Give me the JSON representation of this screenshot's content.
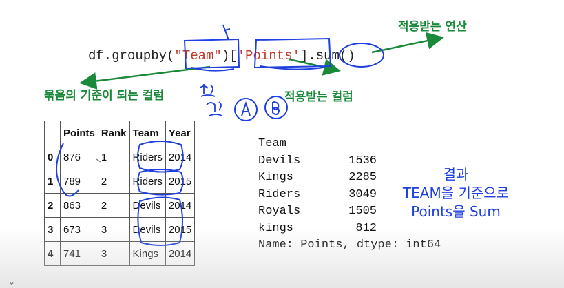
{
  "code": {
    "prefix": "df.groupby(",
    "team_str": "\"Team\"",
    "mid": ")[",
    "points_str": "'Points'",
    "suffix": "].sum()"
  },
  "annotations": {
    "applied_op": "적용받는 연산",
    "group_key": "묶음의 기준이 되는 컬럼",
    "applied_col": "적용받는 컬럼",
    "result_title": "결과",
    "result_line1": "TEAM을 기준으로",
    "result_line2": "Points을 Sum"
  },
  "table": {
    "headers": [
      "",
      "Points",
      "Rank",
      "Team",
      "Year"
    ],
    "rows": [
      [
        "0",
        "876",
        "1",
        "Riders",
        "2014"
      ],
      [
        "1",
        "789",
        "2",
        "Riders",
        "2015"
      ],
      [
        "2",
        "863",
        "2",
        "Devils",
        "2014"
      ],
      [
        "3",
        "673",
        "3",
        "Devils",
        "2015"
      ],
      [
        "4",
        "741",
        "3",
        "Kings",
        "2014"
      ]
    ]
  },
  "series": {
    "index_name": "Team",
    "rows": [
      [
        "Devils",
        "1536"
      ],
      [
        "Kings",
        "2285"
      ],
      [
        "Riders",
        "3049"
      ],
      [
        "Royals",
        "1505"
      ],
      [
        "kings",
        "812"
      ]
    ],
    "footer": "Name: Points, dtype: int64"
  },
  "colors": {
    "ink_blue": "#1f3fe0",
    "arrow_green": "#1a8a3a",
    "string_red": "#c0392b"
  },
  "icons": {
    "bottom": "chevron-down-icon"
  }
}
